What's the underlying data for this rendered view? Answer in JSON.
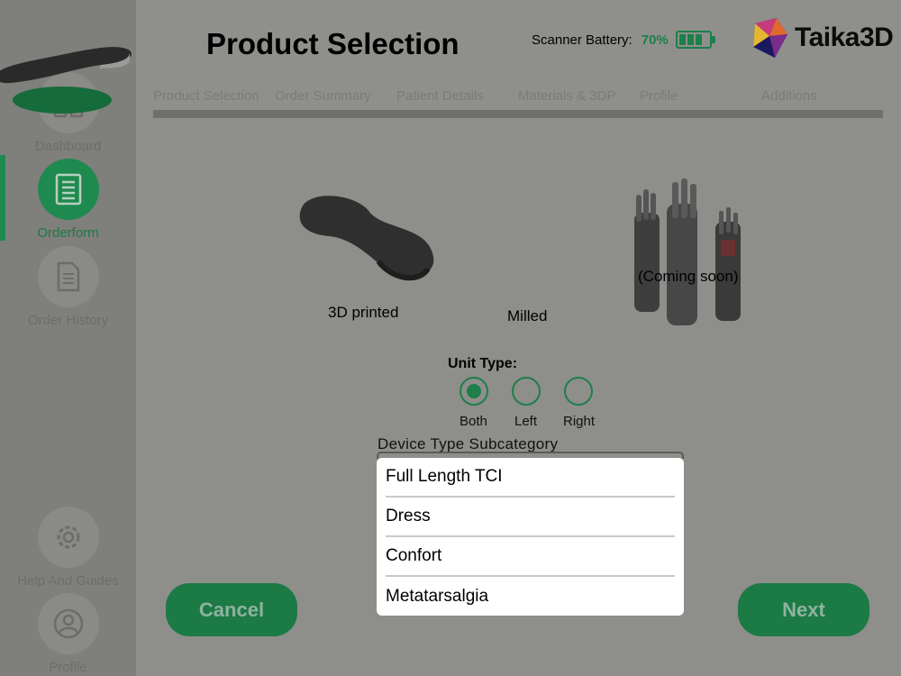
{
  "header": {
    "title": "Product Selection",
    "battery_label": "Scanner Battery:",
    "battery_pct": "70%",
    "brand": "Taika3D"
  },
  "sidebar": {
    "items": [
      {
        "label": "Dashboard",
        "icon": "dashboard-grid-icon"
      },
      {
        "label": "Orderform",
        "icon": "orderform-list-icon",
        "active": true
      },
      {
        "label": "Order History",
        "icon": "document-icon"
      },
      {
        "label": "Help And Guides",
        "icon": "gear-icon"
      },
      {
        "label": "Profile",
        "icon": "user-icon"
      }
    ]
  },
  "steps": [
    "Product Selection",
    "Order Summary",
    "Patient Details",
    "Materials & 3DP",
    "Profile",
    "Additions"
  ],
  "products": [
    {
      "label": "3D printed"
    },
    {
      "label": "Milled",
      "selected": true
    },
    {
      "label": "(Coming soon)"
    }
  ],
  "unit_type": {
    "title": "Unit Type:",
    "options": [
      "Both",
      "Left",
      "Right"
    ],
    "selected": "Both"
  },
  "subcategory": {
    "label": "Device Type Subcategory",
    "options": [
      "Full Length TCI",
      "Dress",
      "Confort",
      "Metatarsalgia"
    ]
  },
  "buttons": {
    "cancel": "Cancel",
    "next": "Next"
  },
  "colors": {
    "accent": "#1c7a45",
    "overlay": "#8f8f8c"
  }
}
